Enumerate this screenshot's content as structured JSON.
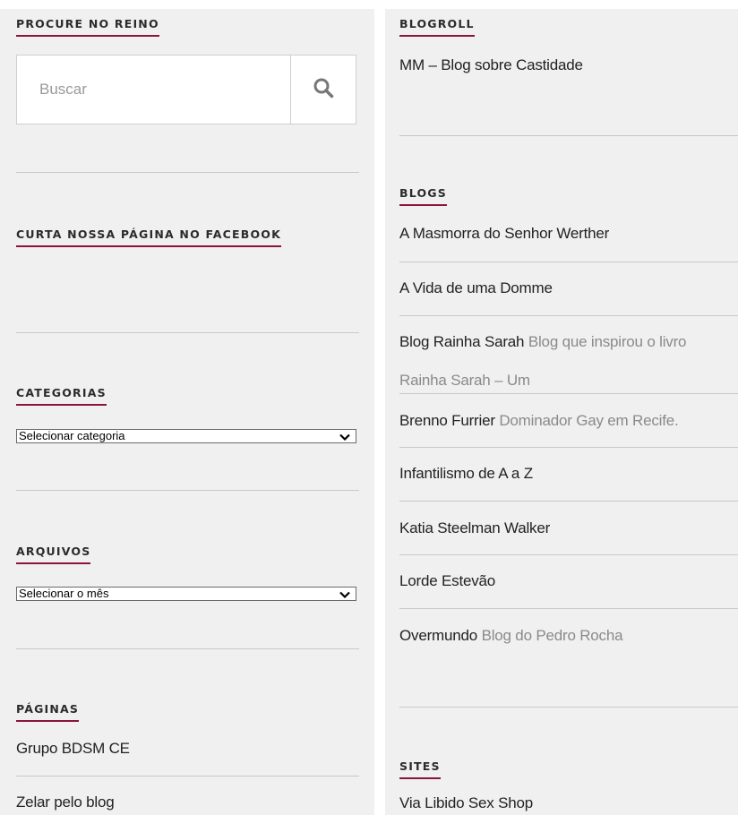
{
  "left": {
    "search": {
      "heading": "PROCURE NO REINO",
      "placeholder": "Buscar",
      "icon": "search-icon"
    },
    "facebook": {
      "heading": "CURTA NOSSA PÁGINA NO FACEBOOK"
    },
    "categories": {
      "heading": "CATEGORIAS",
      "selected": "Selecionar categoria"
    },
    "archives": {
      "heading": "ARQUIVOS",
      "selected": "Selecionar o mês"
    },
    "pages": {
      "heading": "PÁGINAS",
      "items": [
        "Grupo BDSM CE",
        "Zelar pelo blog"
      ]
    }
  },
  "right": {
    "blogroll": {
      "heading": "BLOGROLL",
      "items": [
        {
          "title": "MM – Blog sobre Castidade"
        }
      ]
    },
    "blogs": {
      "heading": "BLOGS",
      "items": [
        {
          "title": "A Masmorra do Senhor Werther"
        },
        {
          "title": "A Vida de uma Domme"
        },
        {
          "title": "Blog Rainha Sarah",
          "desc": "Blog que inspirou o livro",
          "desc_cont": "Rainha Sarah – Um"
        },
        {
          "title": "Brenno Furrier",
          "desc": "Dominador Gay em Recife."
        },
        {
          "title": "Infantilismo de A a Z"
        },
        {
          "title": "Katia Steelman Walker"
        },
        {
          "title": "Lorde Estevão"
        },
        {
          "title": "Overmundo",
          "desc": "Blog do Pedro Rocha"
        }
      ]
    },
    "sites": {
      "heading": "SITES",
      "items": [
        {
          "title": "Via Libido Sex Shop"
        }
      ]
    }
  },
  "colors": {
    "accent": "#8a1538",
    "panel_bg": "#f0f0f0",
    "text": "#222222",
    "muted": "#8a8a8a"
  }
}
